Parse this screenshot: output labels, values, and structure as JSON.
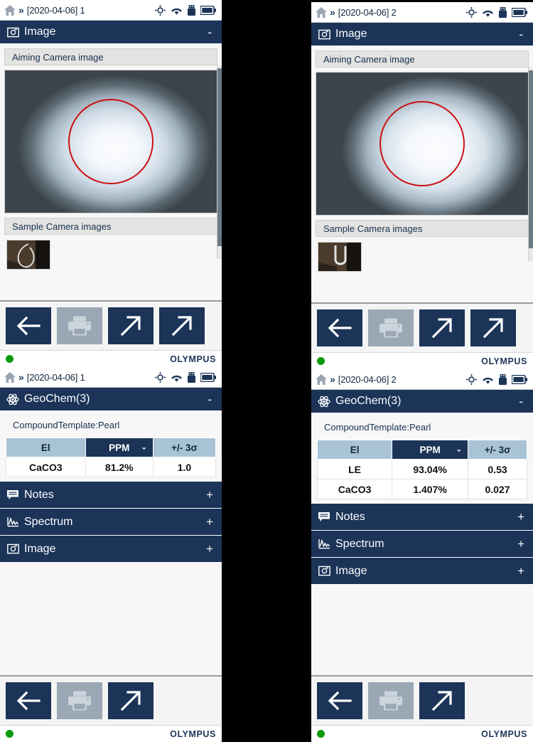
{
  "panels": [
    {
      "id": "left-top",
      "statusbar": {
        "breadcrumb": "[2020-04-06] 1",
        "chevron": "»",
        "icons": [
          "home-icon",
          "target-icon",
          "wifi-icon",
          "usb-drive-icon",
          "battery-icon"
        ]
      },
      "section": {
        "icon": "camera-icon",
        "title": "Image",
        "toggle": "-"
      },
      "aiming_label": "Aiming Camera image",
      "sample_label": "Sample Camera images",
      "toolbar": [
        {
          "name": "back-button",
          "icon": "arrow-left-icon",
          "state": "enabled"
        },
        {
          "name": "print-button",
          "icon": "printer-icon",
          "state": "disabled"
        },
        {
          "name": "export-button-1",
          "icon": "arrow-up-right-icon",
          "state": "enabled"
        },
        {
          "name": "export-button-2",
          "icon": "arrow-up-right-icon",
          "state": "enabled"
        }
      ],
      "footer": {
        "led": "status-led-green",
        "brand": "OLYMPUS"
      }
    },
    {
      "id": "left-bottom",
      "statusbar": {
        "breadcrumb": "[2020-04-06] 1",
        "chevron": "»"
      },
      "section": {
        "icon": "atom-icon",
        "title": "GeoChem(3)",
        "toggle": "-"
      },
      "template_line": "CompoundTemplate:Pearl",
      "table": {
        "headers": [
          "El",
          "PPM",
          "+/- 3σ"
        ],
        "sorted_column": 1,
        "caret": "⌄",
        "rows": [
          [
            "CaCO3",
            "81.2%",
            "1.0"
          ]
        ]
      },
      "accordions": [
        {
          "icon": "notes-icon",
          "label": "Notes",
          "plus": "+"
        },
        {
          "icon": "spectrum-icon",
          "label": "Spectrum",
          "plus": "+"
        },
        {
          "icon": "camera-icon",
          "label": "Image",
          "plus": "+"
        }
      ],
      "toolbar": [
        {
          "name": "back-button",
          "icon": "arrow-left-icon",
          "state": "enabled"
        },
        {
          "name": "print-button",
          "icon": "printer-icon",
          "state": "disabled"
        },
        {
          "name": "export-button-1",
          "icon": "arrow-up-right-icon",
          "state": "enabled"
        }
      ],
      "footer": {
        "led": "status-led-green",
        "brand": "OLYMPUS"
      }
    },
    {
      "id": "right-top",
      "statusbar": {
        "breadcrumb": "[2020-04-06] 2",
        "chevron": "»"
      },
      "section": {
        "icon": "camera-icon",
        "title": "Image",
        "toggle": "-"
      },
      "aiming_label": "Aiming Camera image",
      "sample_label": "Sample Camera images",
      "toolbar": [
        {
          "name": "back-button",
          "icon": "arrow-left-icon",
          "state": "enabled"
        },
        {
          "name": "print-button",
          "icon": "printer-icon",
          "state": "disabled"
        },
        {
          "name": "export-button-1",
          "icon": "arrow-up-right-icon",
          "state": "enabled"
        },
        {
          "name": "export-button-2",
          "icon": "arrow-up-right-icon",
          "state": "enabled"
        }
      ],
      "footer": {
        "led": "status-led-green",
        "brand": "OLYMPUS"
      }
    },
    {
      "id": "right-bottom",
      "statusbar": {
        "breadcrumb": "[2020-04-06] 2",
        "chevron": "»"
      },
      "section": {
        "icon": "atom-icon",
        "title": "GeoChem(3)",
        "toggle": "-"
      },
      "template_line": "CompoundTemplate:Pearl",
      "table": {
        "headers": [
          "El",
          "PPM",
          "+/- 3σ"
        ],
        "sorted_column": 1,
        "caret": "⌄",
        "rows": [
          [
            "LE",
            "93.04%",
            "0.53"
          ],
          [
            "CaCO3",
            "1.407%",
            "0.027"
          ]
        ]
      },
      "accordions": [
        {
          "icon": "notes-icon",
          "label": "Notes",
          "plus": "+"
        },
        {
          "icon": "spectrum-icon",
          "label": "Spectrum",
          "plus": "+"
        },
        {
          "icon": "camera-icon",
          "label": "Image",
          "plus": "+"
        }
      ],
      "toolbar": [
        {
          "name": "back-button",
          "icon": "arrow-left-icon",
          "state": "enabled"
        },
        {
          "name": "print-button",
          "icon": "printer-icon",
          "state": "disabled"
        },
        {
          "name": "export-button-1",
          "icon": "arrow-up-right-icon",
          "state": "enabled"
        }
      ],
      "footer": {
        "led": "status-led-green",
        "brand": "OLYMPUS"
      }
    }
  ],
  "colors": {
    "header_navy": "#1b3458",
    "header_cell": "#a9c3d6",
    "aim_circle": "#cc1111",
    "led_green": "#0b9a0b",
    "disabled_button": "#9aa7b4"
  }
}
